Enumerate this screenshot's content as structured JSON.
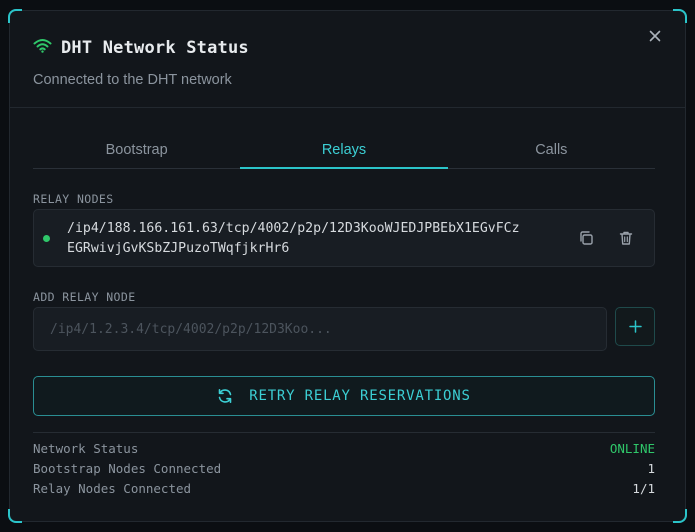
{
  "header": {
    "title": "DHT Network Status",
    "subtitle": "Connected to the DHT network",
    "title_icon": "wifi-icon",
    "close_icon": "close-icon"
  },
  "tabs": [
    {
      "label": "Bootstrap",
      "active": false
    },
    {
      "label": "Relays",
      "active": true
    },
    {
      "label": "Calls",
      "active": false
    }
  ],
  "relay_nodes": {
    "section_label": "RELAY NODES",
    "items": [
      {
        "address_line1": "/ip4/188.166.161.63/tcp/4002/p2p/12D3KooWJEDJPBEbX1EGvFCz",
        "address_line2": "EGRwivjGvKSbZJPuzoTWqfjkrHr6",
        "status_color": "#2fc76a",
        "copy_icon": "copy-icon",
        "delete_icon": "trash-icon"
      }
    ]
  },
  "add_relay": {
    "section_label": "ADD RELAY NODE",
    "placeholder": "/ip4/1.2.3.4/tcp/4002/p2p/12D3Koo...",
    "value": "",
    "add_icon": "plus-icon"
  },
  "retry_button": {
    "label": "RETRY RELAY RESERVATIONS",
    "icon": "refresh-icon"
  },
  "stats": [
    {
      "label": "Network Status",
      "value": "ONLINE"
    },
    {
      "label": "Bootstrap Nodes Connected",
      "value": "1"
    },
    {
      "label": "Relay Nodes Connected",
      "value": "1/1"
    }
  ],
  "colors": {
    "accent": "#2bc4c9",
    "online": "#2fc76a",
    "background": "#12161b"
  }
}
